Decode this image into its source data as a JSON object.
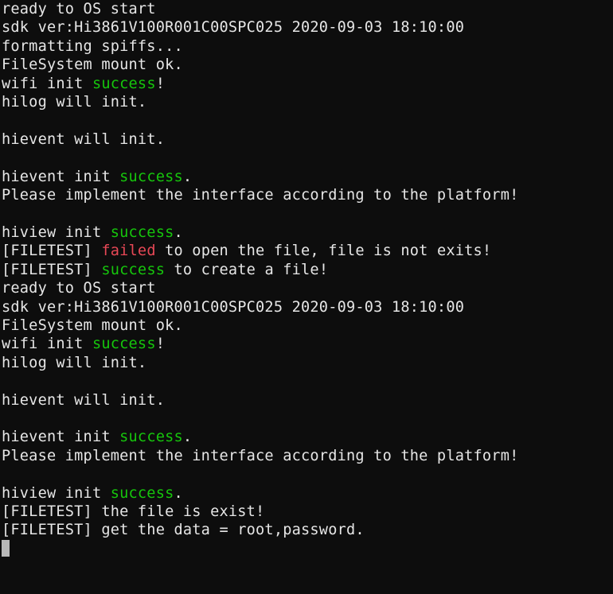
{
  "colors": {
    "bg": "#0d0d0d",
    "fg": "#e6e6e6",
    "green": "#16c60c",
    "red": "#e74856",
    "cursor": "#b8b8b8"
  },
  "lines": [
    {
      "segments": [
        {
          "text": "ready to OS start"
        }
      ]
    },
    {
      "segments": [
        {
          "text": "sdk ver:Hi3861V100R001C00SPC025 2020-09-03 18:10:00"
        }
      ]
    },
    {
      "segments": [
        {
          "text": "formatting spiffs..."
        }
      ]
    },
    {
      "segments": [
        {
          "text": "FileSystem mount ok."
        }
      ]
    },
    {
      "segments": [
        {
          "text": "wifi init "
        },
        {
          "text": "success",
          "color": "green"
        },
        {
          "text": "!"
        }
      ]
    },
    {
      "segments": [
        {
          "text": "hilog will init."
        }
      ]
    },
    {
      "segments": [
        {
          "text": ""
        }
      ]
    },
    {
      "segments": [
        {
          "text": "hievent will init."
        }
      ]
    },
    {
      "segments": [
        {
          "text": ""
        }
      ]
    },
    {
      "segments": [
        {
          "text": "hievent init "
        },
        {
          "text": "success",
          "color": "green"
        },
        {
          "text": "."
        }
      ]
    },
    {
      "segments": [
        {
          "text": "Please implement the interface according to the platform!"
        }
      ]
    },
    {
      "segments": [
        {
          "text": ""
        }
      ]
    },
    {
      "segments": [
        {
          "text": "hiview init "
        },
        {
          "text": "success",
          "color": "green"
        },
        {
          "text": "."
        }
      ]
    },
    {
      "segments": [
        {
          "text": "[FILETEST] "
        },
        {
          "text": "failed",
          "color": "red"
        },
        {
          "text": " to open the file, file is not exits!"
        }
      ]
    },
    {
      "segments": [
        {
          "text": "[FILETEST] "
        },
        {
          "text": "success",
          "color": "green"
        },
        {
          "text": " to create a file!"
        }
      ]
    },
    {
      "segments": [
        {
          "text": "ready to OS start"
        }
      ]
    },
    {
      "segments": [
        {
          "text": "sdk ver:Hi3861V100R001C00SPC025 2020-09-03 18:10:00"
        }
      ]
    },
    {
      "segments": [
        {
          "text": "FileSystem mount ok."
        }
      ]
    },
    {
      "segments": [
        {
          "text": "wifi init "
        },
        {
          "text": "success",
          "color": "green"
        },
        {
          "text": "!"
        }
      ]
    },
    {
      "segments": [
        {
          "text": "hilog will init."
        }
      ]
    },
    {
      "segments": [
        {
          "text": ""
        }
      ]
    },
    {
      "segments": [
        {
          "text": "hievent will init."
        }
      ]
    },
    {
      "segments": [
        {
          "text": ""
        }
      ]
    },
    {
      "segments": [
        {
          "text": "hievent init "
        },
        {
          "text": "success",
          "color": "green"
        },
        {
          "text": "."
        }
      ]
    },
    {
      "segments": [
        {
          "text": "Please implement the interface according to the platform!"
        }
      ]
    },
    {
      "segments": [
        {
          "text": ""
        }
      ]
    },
    {
      "segments": [
        {
          "text": "hiview init "
        },
        {
          "text": "success",
          "color": "green"
        },
        {
          "text": "."
        }
      ]
    },
    {
      "segments": [
        {
          "text": "[FILETEST] the file is exist!"
        }
      ]
    },
    {
      "segments": [
        {
          "text": "[FILETEST] get the data = root,password."
        }
      ]
    }
  ],
  "cursor": true
}
